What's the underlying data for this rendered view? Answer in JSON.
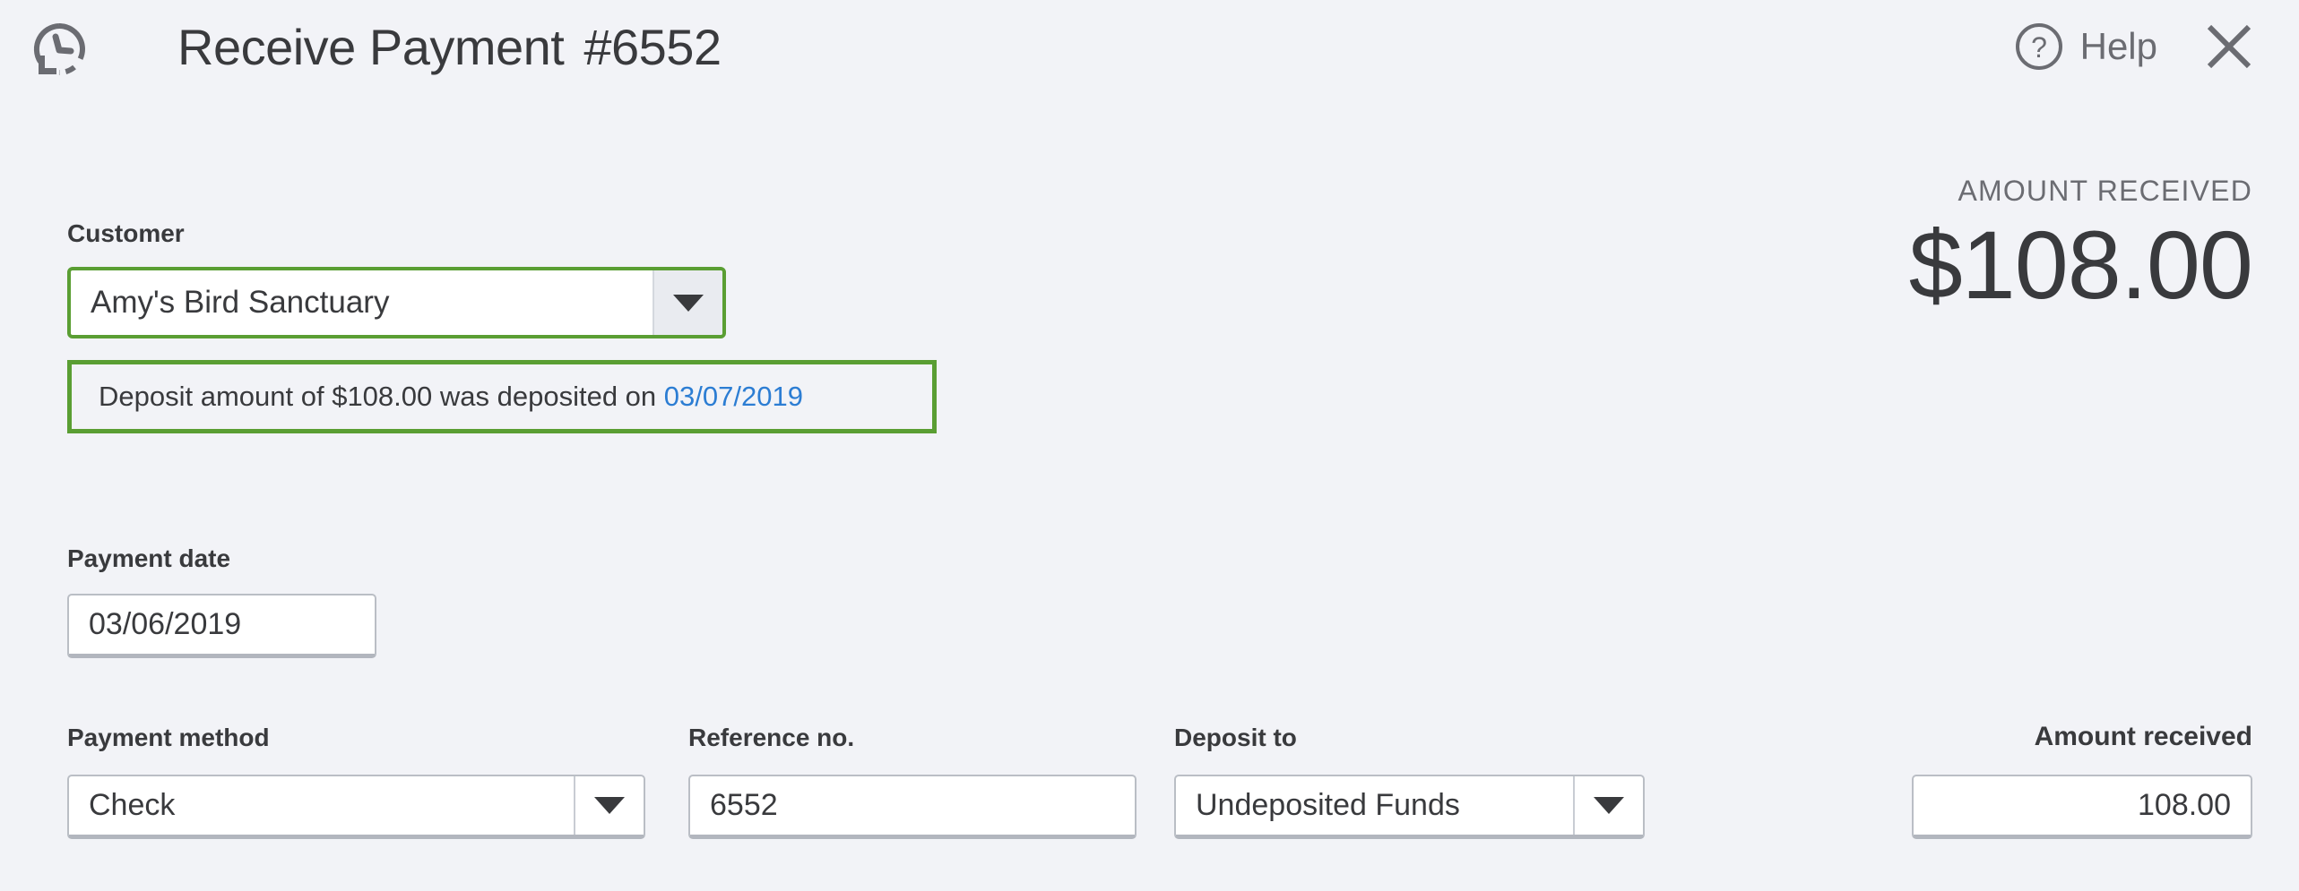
{
  "header": {
    "recurring_icon": "recurring-clock-icon",
    "title": "Receive Payment",
    "doc_number": "#6552",
    "help_icon": "question-circle-icon",
    "help_label": "Help",
    "close_icon": "close-x-icon"
  },
  "customer": {
    "label": "Customer",
    "value": "Amy's Bird Sanctuary",
    "caret_icon": "chevron-down-icon"
  },
  "deposit_notice": {
    "text_before": "Deposit amount of $108.00 was deposited on",
    "link_date": "03/07/2019"
  },
  "amount_panel": {
    "caption": "AMOUNT RECEIVED",
    "value": "$108.00"
  },
  "payment_date": {
    "label": "Payment date",
    "value": "03/06/2019"
  },
  "payment_method": {
    "label": "Payment method",
    "value": "Check",
    "caret_icon": "chevron-down-icon"
  },
  "reference_no": {
    "label": "Reference no.",
    "value": "6552"
  },
  "deposit_to": {
    "label": "Deposit to",
    "value": "Undeposited Funds",
    "caret_icon": "chevron-down-icon"
  },
  "amount_received": {
    "label": "Amount received",
    "value": "108.00"
  },
  "colors": {
    "page_background": "#f2f3f7",
    "text_primary": "#393a3d",
    "text_muted": "#6b6c72",
    "accent_green": "#5a9e33",
    "link_blue": "#2c7dd3",
    "field_border": "#babec5"
  }
}
